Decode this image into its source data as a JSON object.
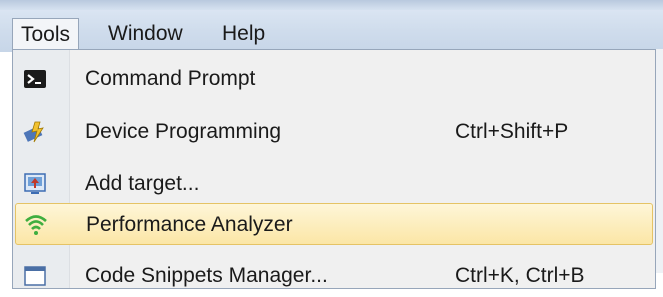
{
  "menubar": {
    "items": [
      {
        "label": "Tools",
        "active": true
      },
      {
        "label": "Window",
        "active": false
      },
      {
        "label": "Help",
        "active": false
      }
    ]
  },
  "dropdown": {
    "items": [
      {
        "label": "Command Prompt",
        "shortcut": "",
        "icon": "command-prompt-icon"
      },
      {
        "label": "Device Programming",
        "shortcut": "Ctrl+Shift+P",
        "icon": "device-programming-icon"
      },
      {
        "label": "Add target...",
        "shortcut": "",
        "icon": "add-target-icon"
      },
      {
        "label": "Performance Analyzer",
        "shortcut": "",
        "icon": "performance-analyzer-icon",
        "highlighted": true
      },
      {
        "label": "Code Snippets Manager...",
        "shortcut": "Ctrl+K, Ctrl+B",
        "icon": "code-snippets-icon"
      }
    ]
  },
  "colors": {
    "highlight": "#fbe6a6",
    "menubar": "#cfdcec",
    "menu_bg": "#f0f0f0"
  }
}
